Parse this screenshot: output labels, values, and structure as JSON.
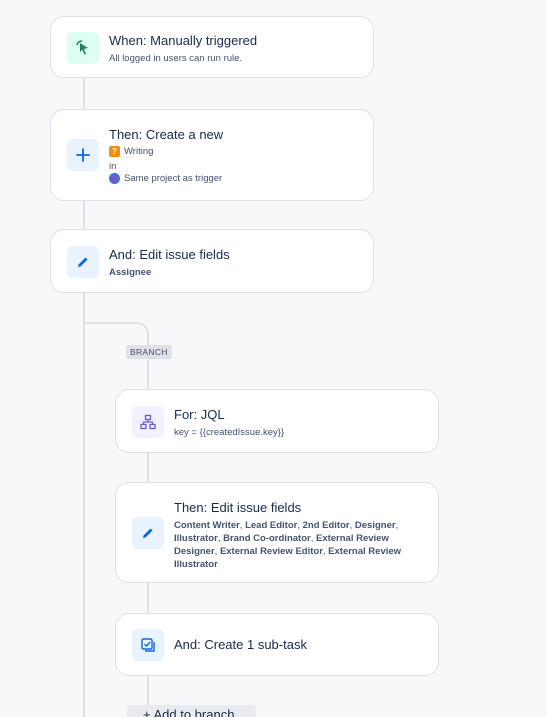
{
  "trigger": {
    "title": "When: Manually triggered",
    "subtitle": "All logged in users can run rule.",
    "icon": "cursor-click-icon"
  },
  "create": {
    "title": "Then: Create a new",
    "type_label": "Writing",
    "in_label": "in",
    "project_label": "Same project as trigger",
    "icon": "plus-icon"
  },
  "edit1": {
    "title": "And: Edit issue fields",
    "field": "Assignee",
    "icon": "pencil-icon"
  },
  "branch": {
    "badge": "BRANCH",
    "jql": {
      "title": "For: JQL",
      "subtitle": "key = {{createdIssue.key}}",
      "icon": "branch-icon"
    },
    "edit2": {
      "title": "Then: Edit issue fields",
      "fields": [
        "Content Writer",
        "Lead Editor",
        "2nd Editor",
        "Designer",
        "Illustrator",
        "Brand Co-ordinator",
        "External Review Designer",
        "External Review Editor",
        "External Review Illustrator"
      ],
      "icon": "pencil-icon"
    },
    "subtask": {
      "title": "And: Create 1 sub-task",
      "icon": "subtask-icon"
    },
    "add_label": "+ Add to branch"
  },
  "colors": {
    "accent_blue": "#0c66e4",
    "icon_bg_blue": "#e9f2ff",
    "icon_bg_green": "#dcfff1",
    "icon_bg_purple": "#f3f0ff",
    "line": "#dfe1e6"
  }
}
